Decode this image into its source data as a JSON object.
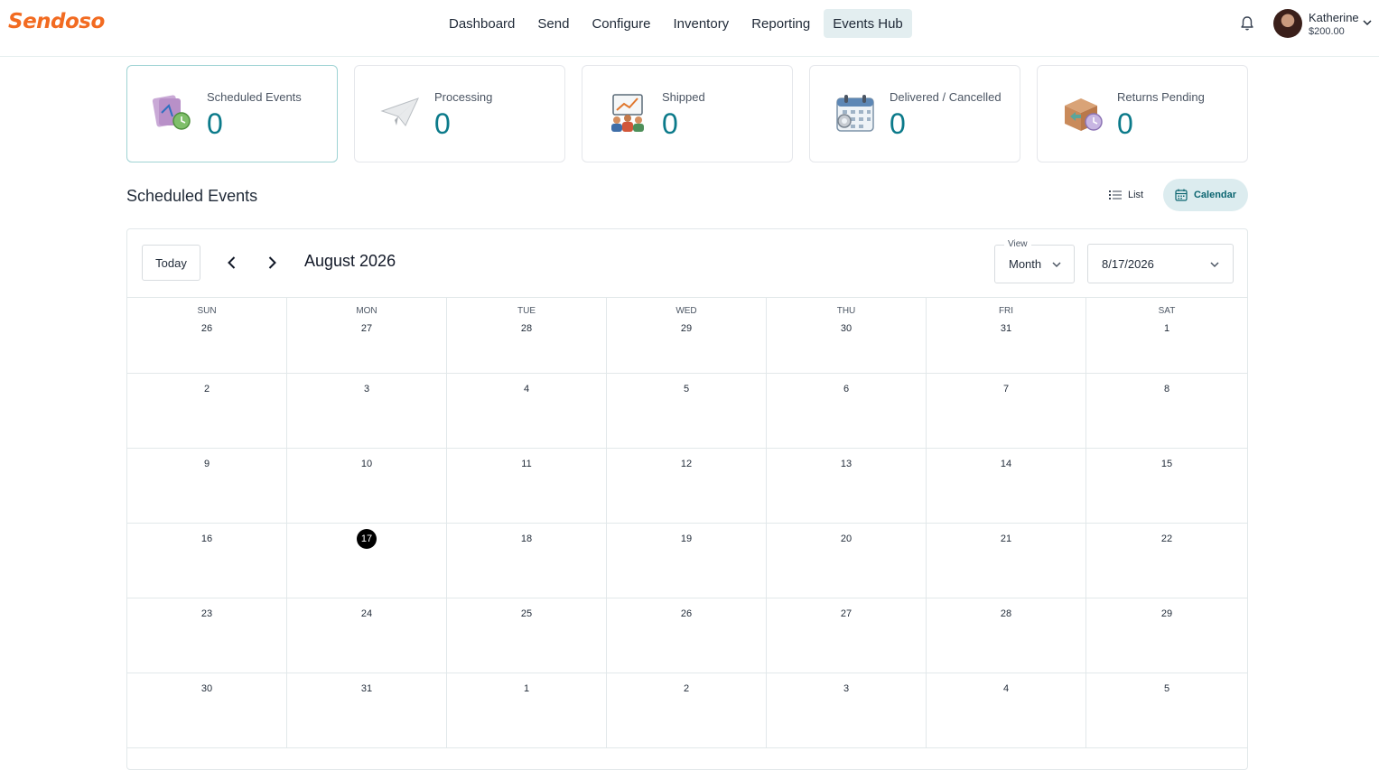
{
  "brand": {
    "logo_text": "Sendoso",
    "accent": "#f26b21",
    "teal": "#0b7a8a"
  },
  "nav": {
    "items": [
      {
        "label": "Dashboard"
      },
      {
        "label": "Send"
      },
      {
        "label": "Configure"
      },
      {
        "label": "Inventory"
      },
      {
        "label": "Reporting"
      },
      {
        "label": "Events Hub",
        "active": true
      }
    ]
  },
  "user": {
    "name": "Katherine",
    "balance": "$200.00",
    "notification_icon": "bell-icon"
  },
  "stats": [
    {
      "label": "Scheduled Events",
      "value": "0",
      "icon": "scheduled-events-icon",
      "active": true
    },
    {
      "label": "Processing",
      "value": "0",
      "icon": "paper-plane-icon"
    },
    {
      "label": "Shipped",
      "value": "0",
      "icon": "shipped-chart-icon"
    },
    {
      "label": "Delivered / Cancelled",
      "value": "0",
      "icon": "calendar-icon"
    },
    {
      "label": "Returns Pending",
      "value": "0",
      "icon": "returns-box-icon"
    }
  ],
  "section": {
    "title": "Scheduled Events",
    "list_label": "List",
    "calendar_label": "Calendar",
    "active_view": "Calendar"
  },
  "calendar": {
    "today_label": "Today",
    "month_title": "August 2026",
    "view_label": "View",
    "view_value": "Month",
    "date_value": "8/17/2026",
    "weekdays": [
      "SUN",
      "MON",
      "TUE",
      "WED",
      "THU",
      "FRI",
      "SAT"
    ],
    "weeks": [
      [
        "26",
        "27",
        "28",
        "29",
        "30",
        "31",
        "1"
      ],
      [
        "2",
        "3",
        "4",
        "5",
        "6",
        "7",
        "8"
      ],
      [
        "9",
        "10",
        "11",
        "12",
        "13",
        "14",
        "15"
      ],
      [
        "16",
        "17",
        "18",
        "19",
        "20",
        "21",
        "22"
      ],
      [
        "23",
        "24",
        "25",
        "26",
        "27",
        "28",
        "29"
      ],
      [
        "30",
        "31",
        "1",
        "2",
        "3",
        "4",
        "5"
      ]
    ],
    "today_day": "17"
  }
}
